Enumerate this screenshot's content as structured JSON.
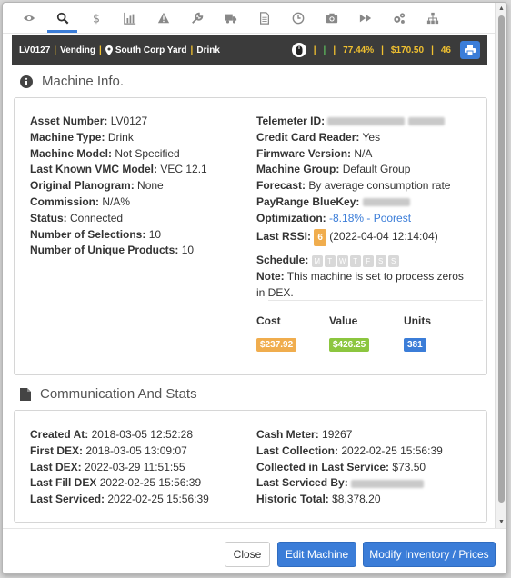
{
  "tabs": [
    {
      "icon": "eye-icon"
    },
    {
      "icon": "search-icon",
      "active": true
    },
    {
      "icon": "dollar-icon"
    },
    {
      "icon": "bar-chart-icon"
    },
    {
      "icon": "warning-icon"
    },
    {
      "icon": "wrench-icon"
    },
    {
      "icon": "truck-icon"
    },
    {
      "icon": "document-icon"
    },
    {
      "icon": "clock-icon"
    },
    {
      "icon": "camera-icon"
    },
    {
      "icon": "fast-forward-icon"
    },
    {
      "icon": "gears-icon"
    },
    {
      "icon": "sitemap-icon"
    }
  ],
  "header": {
    "asset": "LV0127",
    "type": "Vending",
    "location": "South Corp Yard",
    "category": "Drink",
    "percent": "77.44%",
    "amount": "$170.50",
    "count": "46",
    "accent_color": "#f0c030"
  },
  "machine_info": {
    "title": "Machine Info.",
    "left": [
      {
        "label": "Asset Number:",
        "value": "LV0127"
      },
      {
        "label": "Machine Type:",
        "value": "Drink"
      },
      {
        "label": "Machine Model:",
        "value": "Not Specified"
      },
      {
        "label": "Last Known VMC Model:",
        "value": "VEC 12.1"
      },
      {
        "label": "Original Planogram:",
        "value": "None"
      },
      {
        "label": "Commission:",
        "value": "N/A%"
      },
      {
        "label": "Status:",
        "value": "Connected"
      },
      {
        "label": "Number of Selections:",
        "value": "10"
      },
      {
        "label": "Number of Unique Products:",
        "value": "10"
      }
    ],
    "right": [
      {
        "label": "Telemeter ID:",
        "value": ""
      },
      {
        "label": "Credit Card Reader:",
        "value": "Yes"
      },
      {
        "label": "Firmware Version:",
        "value": "N/A"
      },
      {
        "label": "Machine Group:",
        "value": "Default Group"
      },
      {
        "label": "Forecast:",
        "value": "By average consumption rate"
      },
      {
        "label": "PayRange BlueKey:",
        "value": ""
      },
      {
        "label": "Optimization:",
        "value": "-8.18% - Poorest"
      },
      {
        "label": "Last RSSI:",
        "rssi": "6",
        "value": "(2022-04-04 12:14:04)"
      }
    ],
    "schedule_label": "Schedule:",
    "schedule_days": [
      "M",
      "T",
      "W",
      "T",
      "F",
      "S",
      "S"
    ],
    "note_label": "Note:",
    "note_line1": "This machine is set to process zeros",
    "note_line2": "in DEX.",
    "stats": {
      "cost_label": "Cost",
      "cost": "$237.92",
      "cost_color": "#f0ad4e",
      "value_label": "Value",
      "value": "$426.25",
      "value_color": "#8cc63f",
      "units_label": "Units",
      "units": "381",
      "units_color": "#3b7dd8"
    }
  },
  "comm": {
    "title": "Communication And Stats",
    "left": [
      {
        "label": "Created At:",
        "value": "2018-03-05 12:52:28"
      },
      {
        "label": "First DEX:",
        "value": "2018-03-05 13:09:07"
      },
      {
        "label": "Last DEX:",
        "value": "2022-03-29 11:51:55"
      },
      {
        "label": "Last Fill DEX",
        "value": "2022-02-25 15:56:39"
      },
      {
        "label": "Last Serviced:",
        "value": "2022-02-25 15:56:39"
      }
    ],
    "right": [
      {
        "label": "Cash Meter:",
        "value": "19267"
      },
      {
        "label": "Last Collection:",
        "value": "2022-02-25 15:56:39"
      },
      {
        "label": "Collected in Last Service:",
        "value": "$73.50"
      },
      {
        "label": "Last Serviced By:",
        "value": ""
      },
      {
        "label": "Historic Total:",
        "value": "$8,378.20"
      }
    ]
  },
  "footer": {
    "close_label": "Close",
    "edit_label": "Edit Machine",
    "modify_label": "Modify Inventory / Prices"
  }
}
